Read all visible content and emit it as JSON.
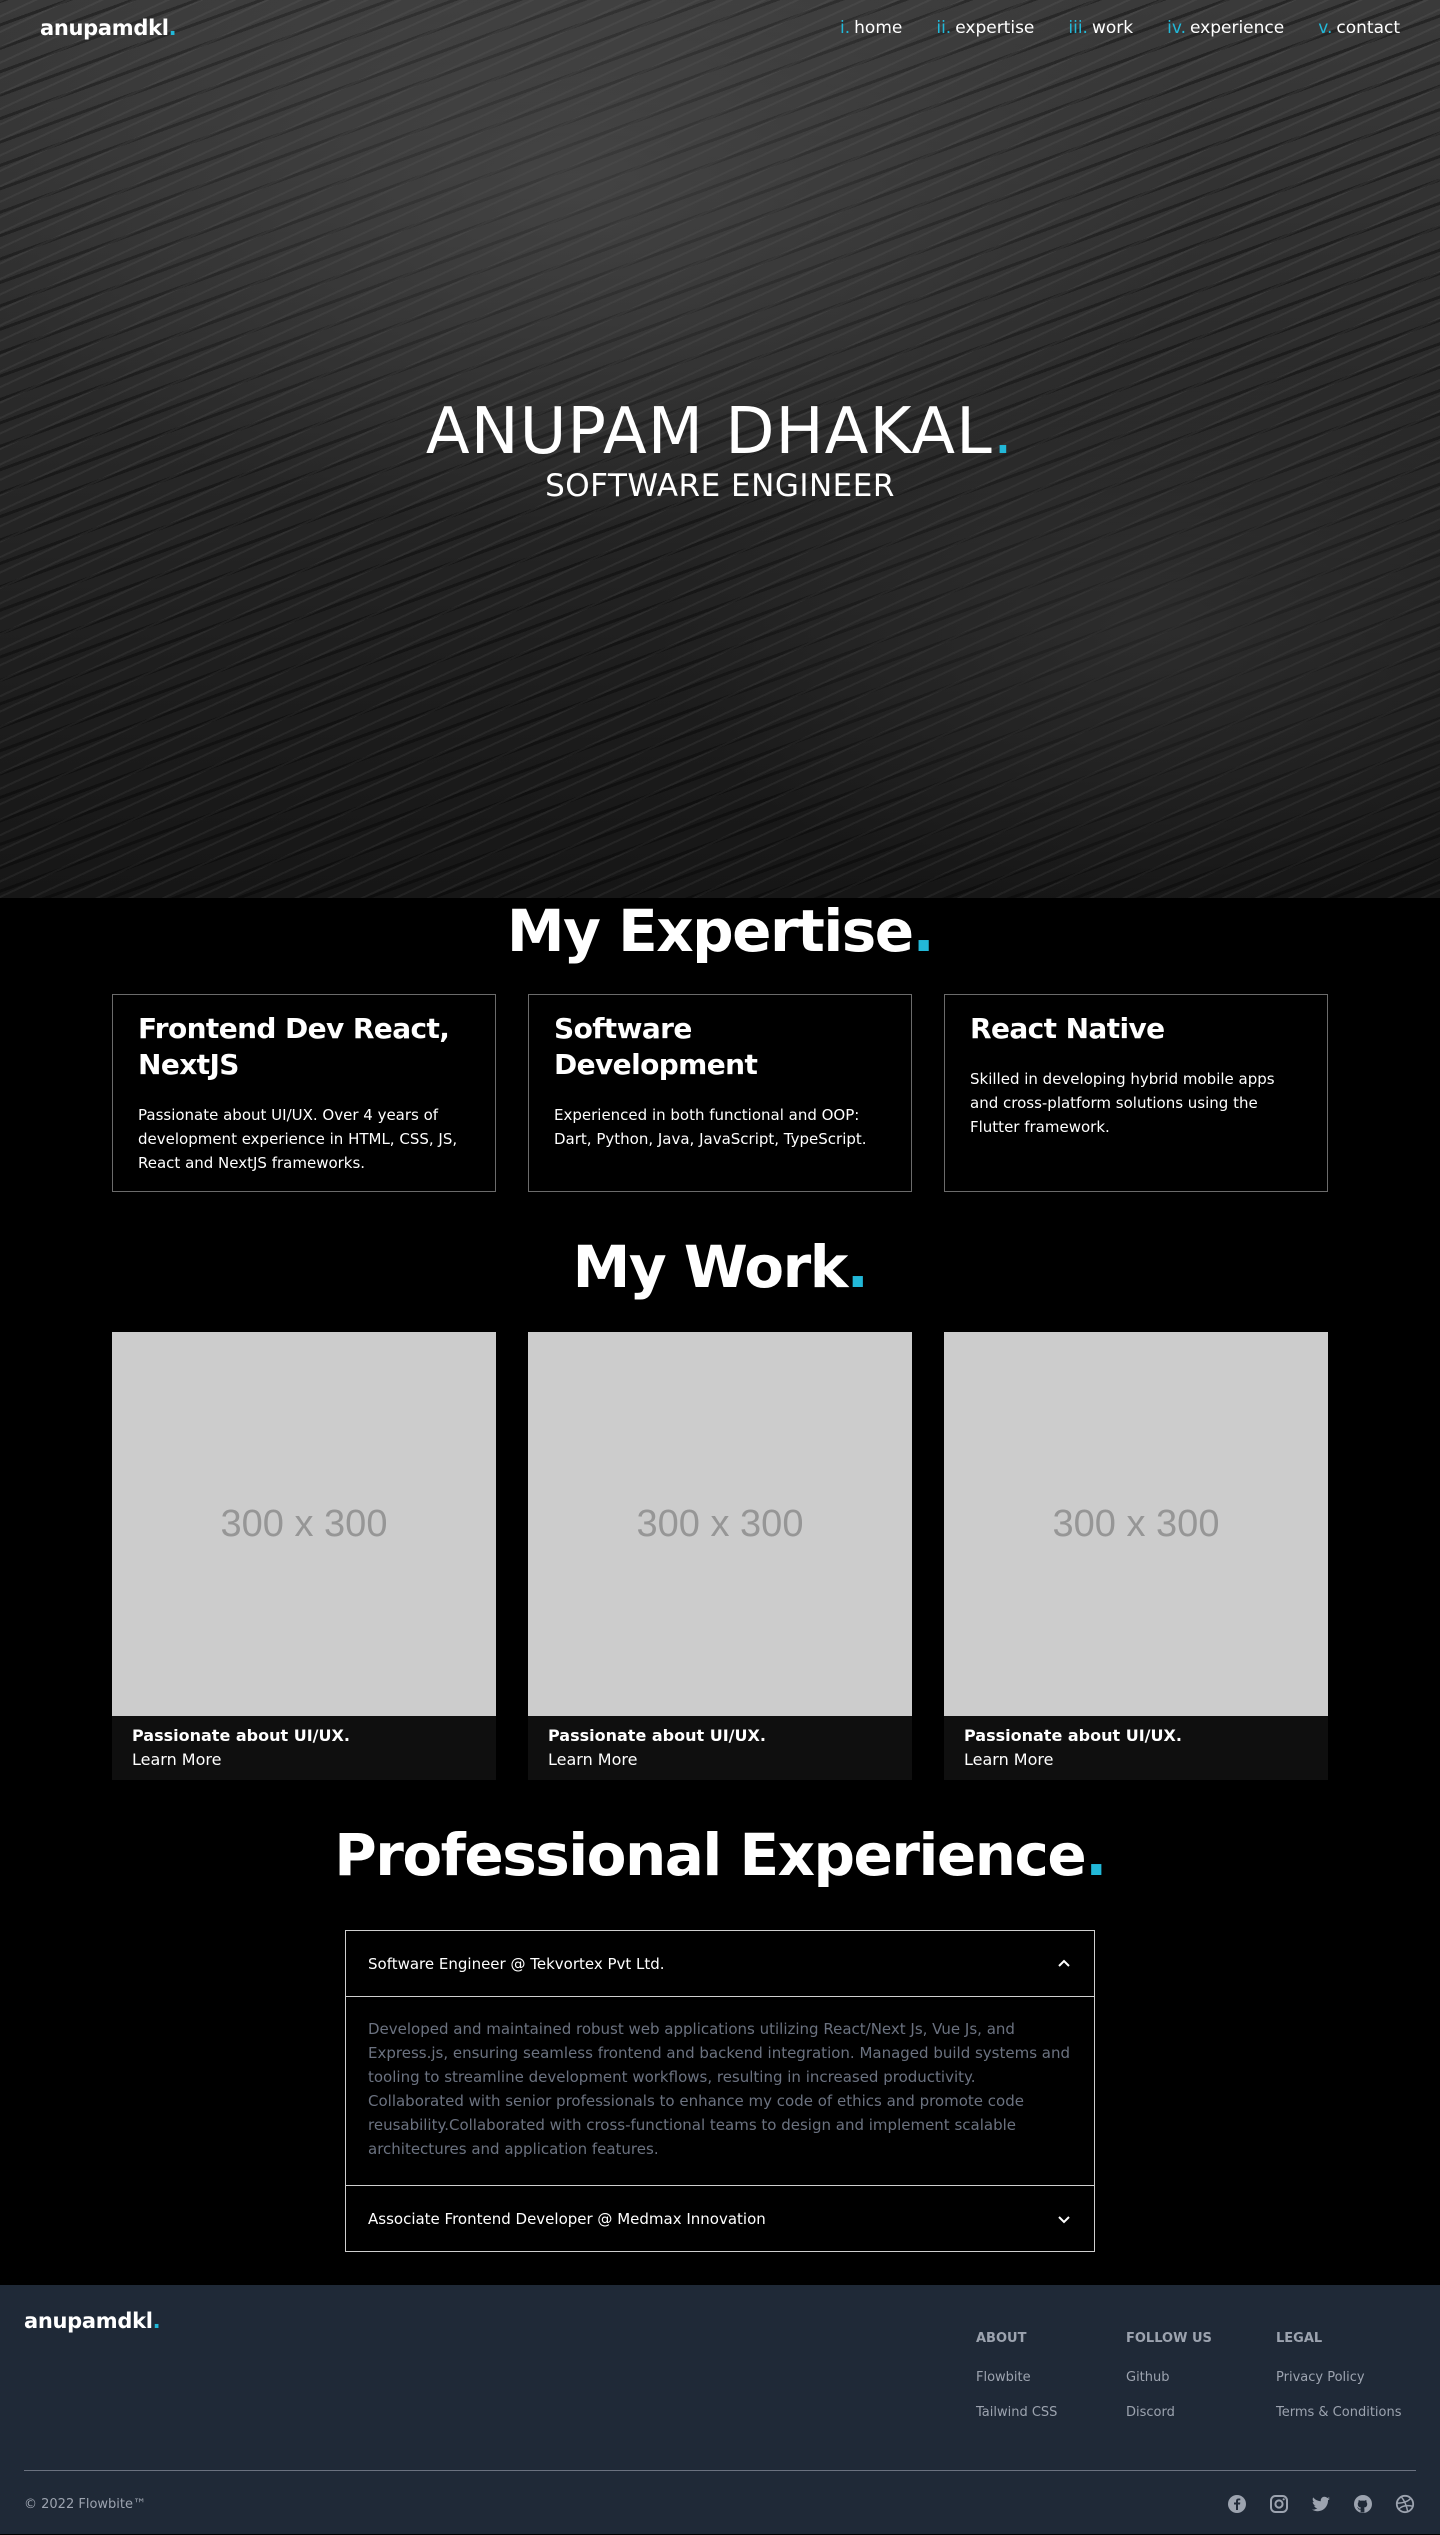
{
  "nav": {
    "logo": "anupamdkl",
    "logo_dot": ".",
    "links": [
      {
        "num": "i.",
        "label": "home"
      },
      {
        "num": "ii.",
        "label": "expertise"
      },
      {
        "num": "iii.",
        "label": "work"
      },
      {
        "num": "iv.",
        "label": "experience"
      },
      {
        "num": "v.",
        "label": "contact"
      }
    ]
  },
  "hero": {
    "name": "ANUPAM DHAKAL",
    "dot": ".",
    "role": "SOFTWARE ENGINEER"
  },
  "expertise": {
    "title": "My Expertise",
    "dot": ".",
    "cards": [
      {
        "title": "Frontend Dev React, NextJS",
        "text": "Passionate about UI/UX. Over 4 years of development experience in HTML, CSS, JS, React and NextJS frameworks."
      },
      {
        "title": "Software Development",
        "text": "Experienced in both functional and OOP: Dart, Python, Java, JavaScript, TypeScript."
      },
      {
        "title": "React Native",
        "text": "Skilled in developing hybrid mobile apps and cross-platform solutions using the Flutter framework."
      }
    ]
  },
  "work": {
    "title": "My Work",
    "dot": ".",
    "cards": [
      {
        "placeholder": "300 x 300",
        "title": "Passionate about UI/UX.",
        "link": "Learn More"
      },
      {
        "placeholder": "300 x 300",
        "title": "Passionate about UI/UX.",
        "link": "Learn More"
      },
      {
        "placeholder": "300 x 300",
        "title": "Passionate about UI/UX.",
        "link": "Learn More"
      }
    ]
  },
  "experience": {
    "title": "Professional Experience",
    "dot": ".",
    "items": [
      {
        "heading": "Software Engineer @ Tekvortex Pvt Ltd.",
        "expanded": true,
        "body": "Developed and maintained robust web applications utilizing React/Next Js, Vue Js, and Express.js, ensuring seamless frontend and backend integration. Managed build systems and tooling to streamline development workflows, resulting in increased productivity. Collaborated with senior professionals to enhance my code of ethics and promote code reusability.Collaborated with cross-functional teams to design and implement scalable architectures and application features."
      },
      {
        "heading": "Associate Frontend Developer @ Medmax Innovation",
        "expanded": false
      }
    ]
  },
  "footer": {
    "logo": "anupamdkl",
    "logo_dot": ".",
    "columns": [
      {
        "heading": "ABOUT",
        "links": [
          "Flowbite",
          "Tailwind CSS"
        ]
      },
      {
        "heading": "FOLLOW US",
        "links": [
          "Github",
          "Discord"
        ]
      },
      {
        "heading": "LEGAL",
        "links": [
          "Privacy Policy",
          "Terms & Conditions"
        ]
      }
    ],
    "copyright": "© 2022 Flowbite™",
    "socials": [
      "facebook-icon",
      "instagram-icon",
      "twitter-icon",
      "github-icon",
      "dribbble-icon"
    ]
  },
  "colors": {
    "accent": "#22b8d8",
    "footer_bg": "#1f2937",
    "muted_text": "#9ca3af",
    "placeholder_bg": "#cccccc"
  }
}
